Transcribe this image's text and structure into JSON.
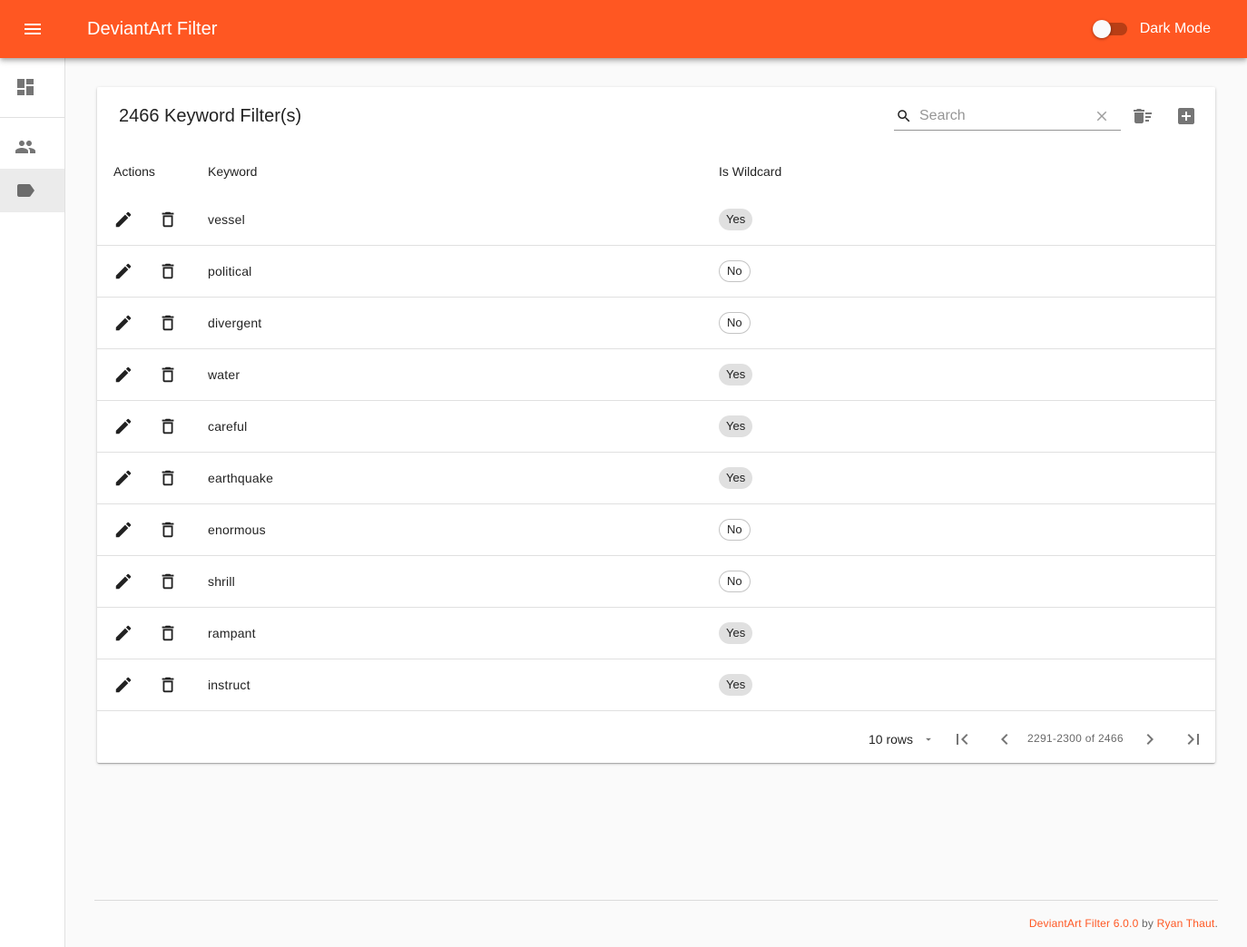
{
  "app": {
    "title": "DeviantArt Filter",
    "dark_mode_label": "Dark Mode",
    "accent_color": "#ff5722"
  },
  "sidenav": {
    "items": [
      {
        "icon": "dashboard-icon"
      },
      {
        "icon": "people-icon"
      },
      {
        "icon": "label-icon",
        "active": true
      }
    ]
  },
  "card": {
    "title": "2466 Keyword Filter(s)",
    "search_placeholder": "Search",
    "search_value": ""
  },
  "table": {
    "headers": {
      "actions": "Actions",
      "keyword": "Keyword",
      "wildcard": "Is Wildcard"
    },
    "rows": [
      {
        "keyword": "vessel",
        "wildcard": "Yes"
      },
      {
        "keyword": "political",
        "wildcard": "No"
      },
      {
        "keyword": "divergent",
        "wildcard": "No"
      },
      {
        "keyword": "water",
        "wildcard": "Yes"
      },
      {
        "keyword": "careful",
        "wildcard": "Yes"
      },
      {
        "keyword": "earthquake",
        "wildcard": "Yes"
      },
      {
        "keyword": "enormous",
        "wildcard": "No"
      },
      {
        "keyword": "shrill",
        "wildcard": "No"
      },
      {
        "keyword": "rampant",
        "wildcard": "Yes"
      },
      {
        "keyword": "instruct",
        "wildcard": "Yes"
      }
    ]
  },
  "pagination": {
    "rows_label": "10 rows",
    "range_label": "2291-2300 of 2466"
  },
  "footer": {
    "product": "DeviantArt Filter 6.0.0",
    "by": " by ",
    "author": "Ryan Thaut",
    "end": "."
  }
}
